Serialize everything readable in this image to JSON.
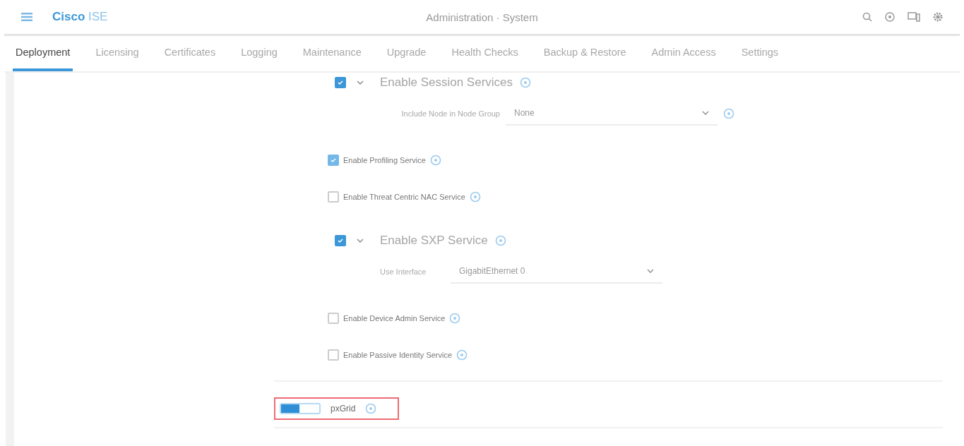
{
  "header": {
    "brand": "Cisco",
    "product": "ISE",
    "title": "Administration · System"
  },
  "tabs": [
    {
      "label": "Deployment",
      "selected": true
    },
    {
      "label": "Licensing",
      "selected": false
    },
    {
      "label": "Certificates",
      "selected": false
    },
    {
      "label": "Logging",
      "selected": false
    },
    {
      "label": "Maintenance",
      "selected": false
    },
    {
      "label": "Upgrade",
      "selected": false
    },
    {
      "label": "Health Checks",
      "selected": false
    },
    {
      "label": "Backup & Restore",
      "selected": false
    },
    {
      "label": "Admin Access",
      "selected": false
    },
    {
      "label": "Settings",
      "selected": false
    }
  ],
  "services": [
    {
      "kind": "section",
      "label": "Enable Session Services",
      "checked": true,
      "expanded": true,
      "field": {
        "label": "Include Node in Node Group",
        "value": "None",
        "info": true
      }
    },
    {
      "kind": "item",
      "label": "Enable Profiling Service",
      "checked": true
    },
    {
      "kind": "item",
      "label": "Enable Threat Centric NAC Service",
      "checked": false
    },
    {
      "kind": "section",
      "label": "Enable SXP Service",
      "checked": true,
      "expanded": true,
      "field": {
        "label": "Use Interface",
        "value": "GigabitEthernet 0",
        "info": false
      }
    },
    {
      "kind": "item",
      "label": "Enable Device Admin Service",
      "checked": false
    },
    {
      "kind": "item",
      "label": "Enable Passive Identity Service",
      "checked": false
    }
  ],
  "pxgrid": {
    "label": "pxGrid",
    "on": true,
    "highlighted": true
  }
}
